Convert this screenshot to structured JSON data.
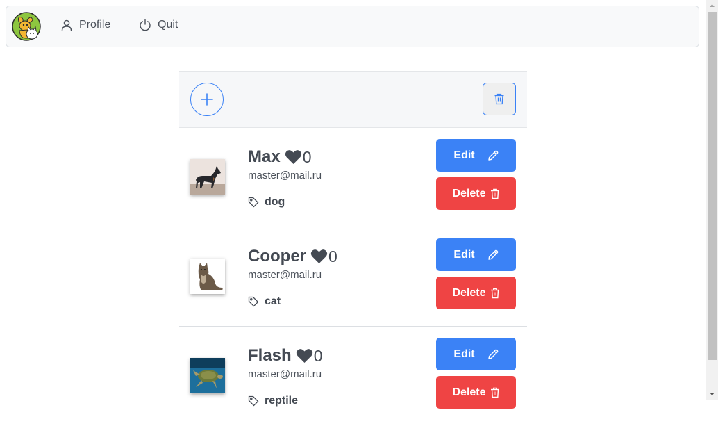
{
  "nav": {
    "profile_label": "Profile",
    "quit_label": "Quit"
  },
  "pets": [
    {
      "name": "Max",
      "likes": "0",
      "email": "master@mail.ru",
      "tag": "dog",
      "edit_label": "Edit",
      "delete_label": "Delete",
      "photo": "doberman"
    },
    {
      "name": "Cooper",
      "likes": "0",
      "email": "master@mail.ru",
      "tag": "cat",
      "edit_label": "Edit",
      "delete_label": "Delete",
      "photo": "maine-coon-cat"
    },
    {
      "name": "Flash",
      "likes": "0",
      "email": "master@mail.ru",
      "tag": "reptile",
      "edit_label": "Edit",
      "delete_label": "Delete",
      "photo": "sea-turtle"
    }
  ],
  "colors": {
    "primary": "#3b82f6",
    "danger": "#ef4444",
    "text": "#444a53"
  }
}
